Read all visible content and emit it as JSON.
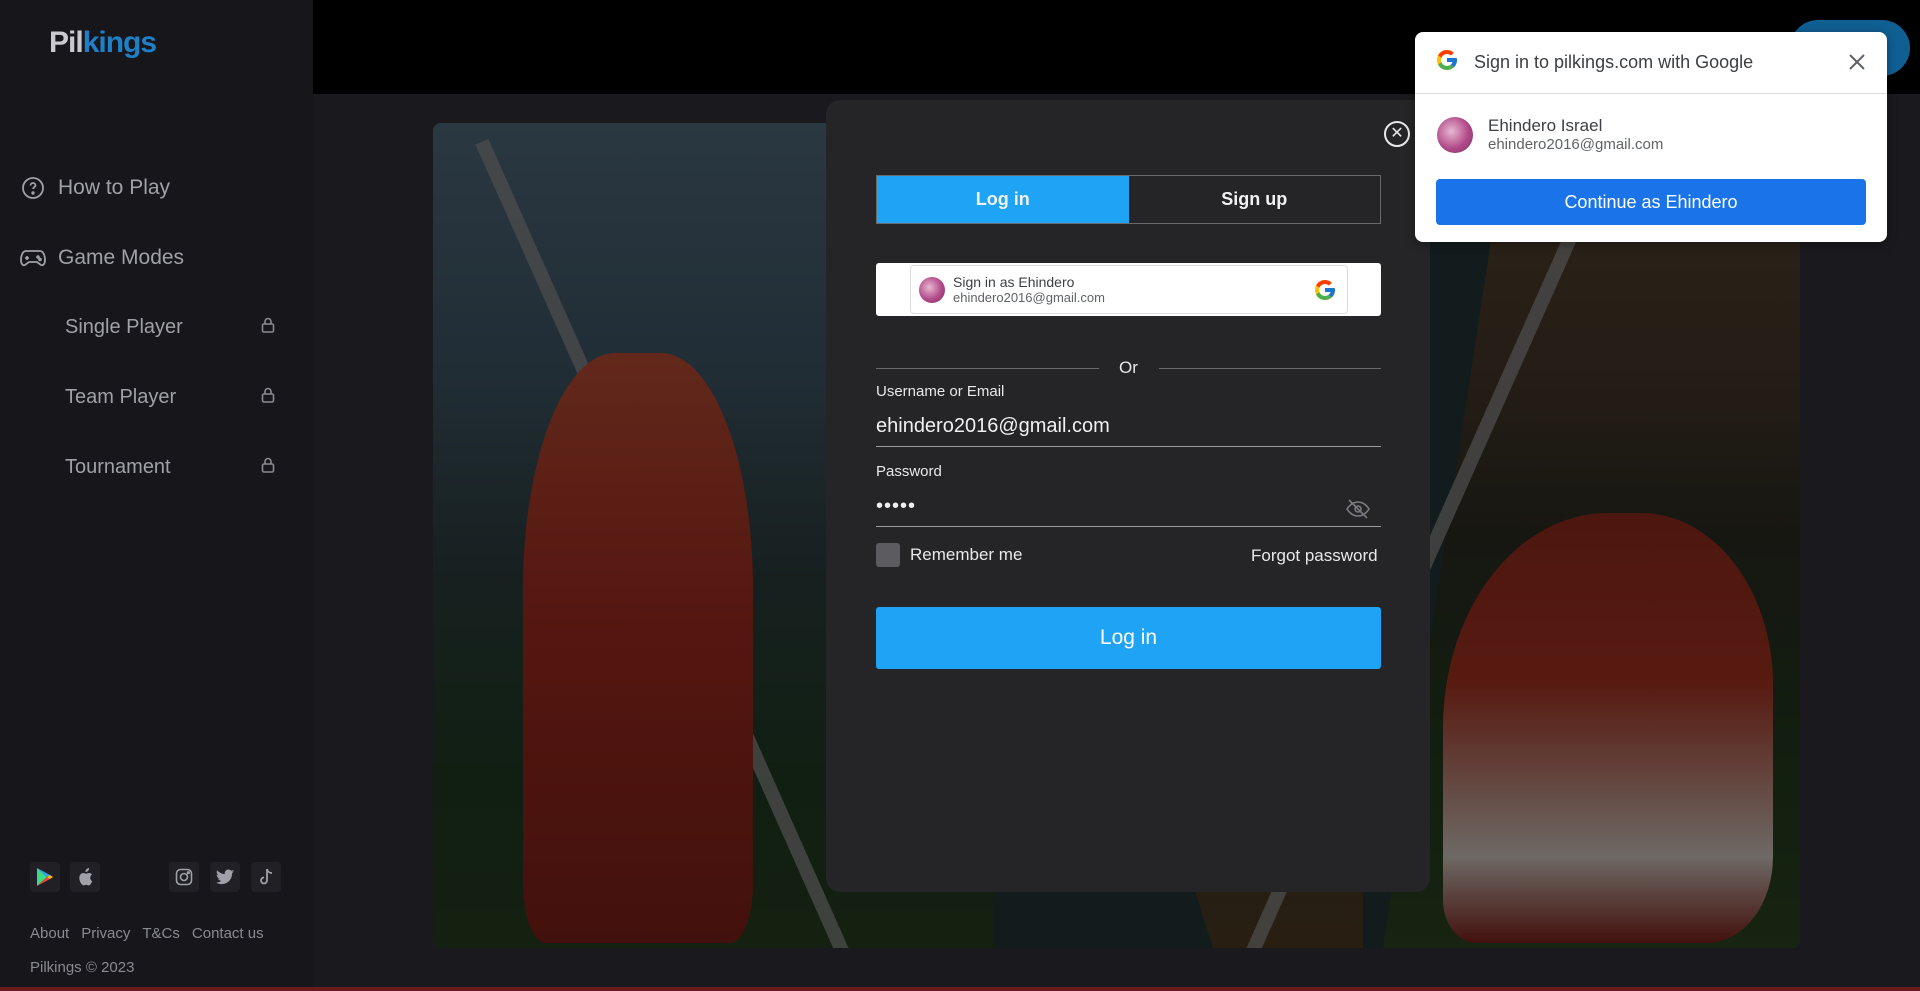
{
  "logo": {
    "part1": "Pil",
    "part2": "kings"
  },
  "sidebar": {
    "nav": [
      {
        "label": "How to Play",
        "icon": "help-circle-icon"
      },
      {
        "label": "Game Modes",
        "icon": "gamepad-icon"
      }
    ],
    "modes": [
      {
        "label": "Single Player",
        "locked": true
      },
      {
        "label": "Team Player",
        "locked": true
      },
      {
        "label": "Tournament",
        "locked": true
      }
    ],
    "stores": [
      "google-play-icon",
      "apple-icon"
    ],
    "socials": [
      "instagram-icon",
      "twitter-icon",
      "tiktok-icon"
    ],
    "footer_links": [
      "About",
      "Privacy",
      "T&Cs",
      "Contact us"
    ],
    "copyright": "Pilkings © 2023"
  },
  "modal": {
    "tabs": [
      {
        "label": "Log in",
        "active": true
      },
      {
        "label": "Sign up",
        "active": false
      }
    ],
    "google_button": {
      "name_line": "Sign in as Ehindero",
      "email_line": "ehindero2016@gmail.com"
    },
    "divider_text": "Or",
    "username": {
      "label": "Username or Email",
      "value": "ehindero2016@gmail.com"
    },
    "password": {
      "label": "Password",
      "value": "•••••"
    },
    "remember_label": "Remember me",
    "remember_checked": false,
    "forgot_label": "Forgot password",
    "submit_label": "Log in"
  },
  "google_popup": {
    "title": "Sign in to pilkings.com with Google",
    "account_name": "Ehindero Israel",
    "account_email": "ehindero2016@gmail.com",
    "continue_label": "Continue as Ehindero"
  },
  "colors": {
    "accent": "#1ea3f5",
    "google_blue": "#1a73e8",
    "sidebar_bg": "#16161b",
    "modal_bg": "#252528"
  }
}
